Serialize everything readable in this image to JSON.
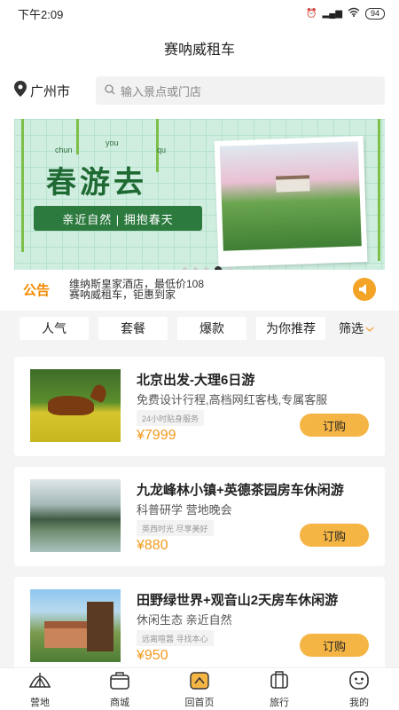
{
  "status": {
    "time": "下午2:09",
    "battery": "94"
  },
  "header": {
    "title": "赛呐威租车"
  },
  "location": {
    "city": "广州市"
  },
  "search": {
    "placeholder": "输入景点或门店"
  },
  "banner": {
    "pinyin": [
      "chun",
      "you",
      "qu"
    ],
    "title": "春游去",
    "slogan": "亲近自然 | 拥抱春天"
  },
  "notice": {
    "label": "公告",
    "lines": [
      "维纳斯皇家酒店，最低价108",
      "赛呐威租车，钜惠到家"
    ]
  },
  "tags": [
    "人气",
    "套餐",
    "爆款",
    "为你推荐"
  ],
  "filter_label": "筛选",
  "cards": [
    {
      "title": "北京出发-大理6日游",
      "desc": "免费设计行程,高档网红客栈,专属客服",
      "badge": "24小时贴身服务",
      "price": "¥7999",
      "button": "订购"
    },
    {
      "title": "九龙峰林小镇+英德茶园房车休闲游",
      "desc": "科普研学 营地晚会",
      "badge": "英西时光 尽享美好",
      "price": "¥880",
      "button": "订购"
    },
    {
      "title": "田野绿世界+观音山2天房车休闲游",
      "desc": "休闲生态 亲近自然",
      "badge": "远离喧嚣 寻找本心",
      "price": "¥950",
      "button": "订购"
    }
  ],
  "tabbar": [
    {
      "label": "营地",
      "icon": "camp-icon"
    },
    {
      "label": "商城",
      "icon": "shop-icon"
    },
    {
      "label": "回首页",
      "icon": "home-icon"
    },
    {
      "label": "旅行",
      "icon": "luggage-icon"
    },
    {
      "label": "我的",
      "icon": "profile-icon"
    }
  ]
}
